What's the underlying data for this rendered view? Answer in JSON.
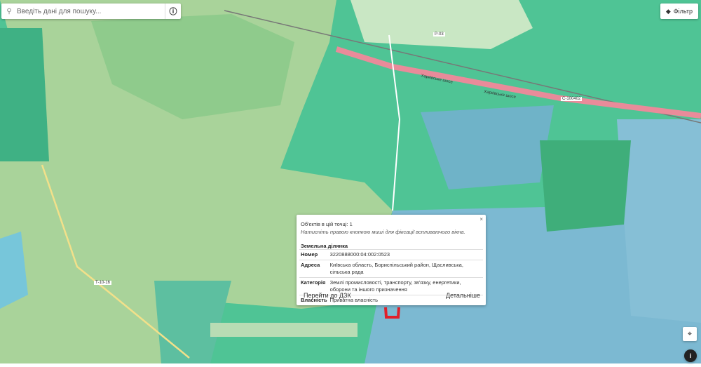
{
  "search": {
    "placeholder": "Введіть дані для пошуку...",
    "search_icon": "search-icon",
    "info_icon": "info-icon"
  },
  "filter": {
    "label": "Фільтр",
    "icon": "layers-icon"
  },
  "map_labels": {
    "road_1": "Харківське шосе",
    "road_2": "Харківське шосе",
    "road_code_1": "С-100402",
    "road_code_2": "Т-10-16",
    "road_code_3": "Р-03"
  },
  "popup": {
    "count": "Об'єктів в цій точці: 1",
    "hint": "Натисніть правою кнопкою миші для фіксації вспливаючого вікна.",
    "type": "Земельна ділянка",
    "rows": [
      {
        "key": "Номер",
        "value": "3220888000:04:002:0523"
      },
      {
        "key": "Адреса",
        "value": "Київська область, Бориспільський район, Щасливська, сільська рада"
      },
      {
        "key": "Категорія",
        "value": "Землі промисловості, транспорту, зв'язку, енергетики, оборони та іншого призначення"
      },
      {
        "key": "Власність",
        "value": "Приватна власність"
      }
    ],
    "goto_label": "Перейти до ДЗК",
    "details_label": "Детальніше",
    "close": "×"
  },
  "controls": {
    "locate_icon": "crosshair-icon",
    "info_icon": "info-icon",
    "info_text": "i"
  },
  "colors": {
    "parcel_green": "#4fc495",
    "forest": "#a9d39a",
    "parcel_blue": "#7cb9d2",
    "highway": "#e98b9a",
    "selected": "#e0202a"
  }
}
